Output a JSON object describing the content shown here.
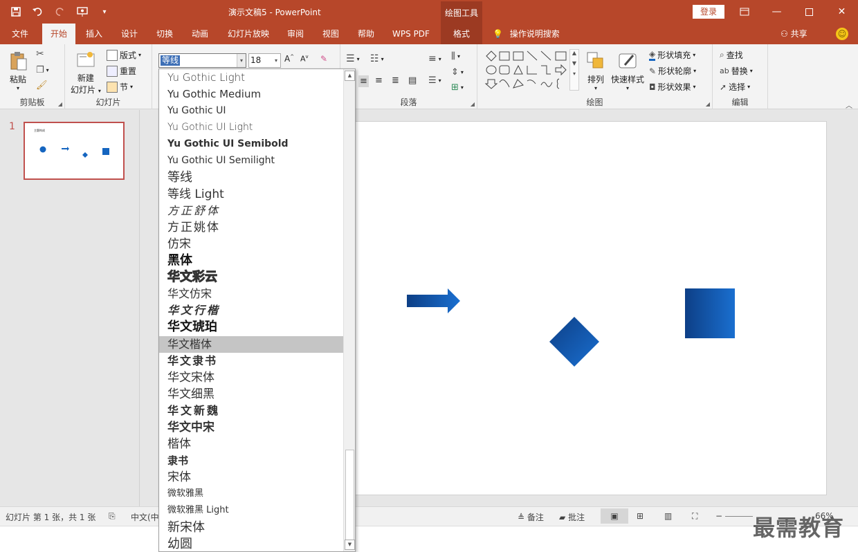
{
  "titlebar": {
    "doc_title": "演示文稿5  -  PowerPoint",
    "context_tool": "绘图工具",
    "login": "登录"
  },
  "tabs": [
    {
      "label": "文件"
    },
    {
      "label": "开始"
    },
    {
      "label": "插入"
    },
    {
      "label": "设计"
    },
    {
      "label": "切换"
    },
    {
      "label": "动画"
    },
    {
      "label": "幻灯片放映"
    },
    {
      "label": "审阅"
    },
    {
      "label": "视图"
    },
    {
      "label": "帮助"
    },
    {
      "label": "WPS PDF"
    },
    {
      "label": "格式"
    }
  ],
  "tellme": "操作说明搜索",
  "share": "共享",
  "ribbon": {
    "clipboard": {
      "paste": "粘贴",
      "label": "剪贴板"
    },
    "slides": {
      "new_slide_1": "新建",
      "new_slide_2": "幻灯片",
      "layout": "版式",
      "reset": "重置",
      "section": "节",
      "label": "幻灯片"
    },
    "font": {
      "name": "等线",
      "size": "18"
    },
    "paragraph": {
      "label": "段落"
    },
    "drawing": {
      "arrange": "排列",
      "quick_styles": "快速样式",
      "fill": "形状填充",
      "outline": "形状轮廓",
      "effects": "形状效果",
      "label": "绘图"
    },
    "editing": {
      "find": "查找",
      "replace": "替换",
      "select": "选择",
      "label": "编辑"
    }
  },
  "thumbnail": {
    "number": "1",
    "title": "主题构成"
  },
  "font_list": [
    "Yu Gothic Light",
    "Yu Gothic Medium",
    "Yu Gothic UI",
    "Yu Gothic UI Light",
    "Yu Gothic UI Semibold",
    "Yu Gothic UI Semilight",
    "等线",
    "等线 Light",
    "方正舒体",
    "方正姚体",
    "仿宋",
    "黑体",
    "华文彩云",
    "华文仿宋",
    "华文行楷",
    "华文琥珀",
    "华文楷体",
    "华文隶书",
    "华文宋体",
    "华文细黑",
    "华文新魏",
    "华文中宋",
    "楷体",
    "隶书",
    "宋体",
    "微软雅黑",
    "微软雅黑 Light",
    "新宋体",
    "幼圆"
  ],
  "status": {
    "slide_info": "幻灯片 第 1 张，共 1 张",
    "language": "中文(中",
    "notes": "备注",
    "comments": "批注",
    "zoom": "66%"
  },
  "watermark": "最需教育",
  "colors": {
    "accent": "#b7472a",
    "context": "#9c3a22",
    "shape_blue": "#1565c0"
  }
}
